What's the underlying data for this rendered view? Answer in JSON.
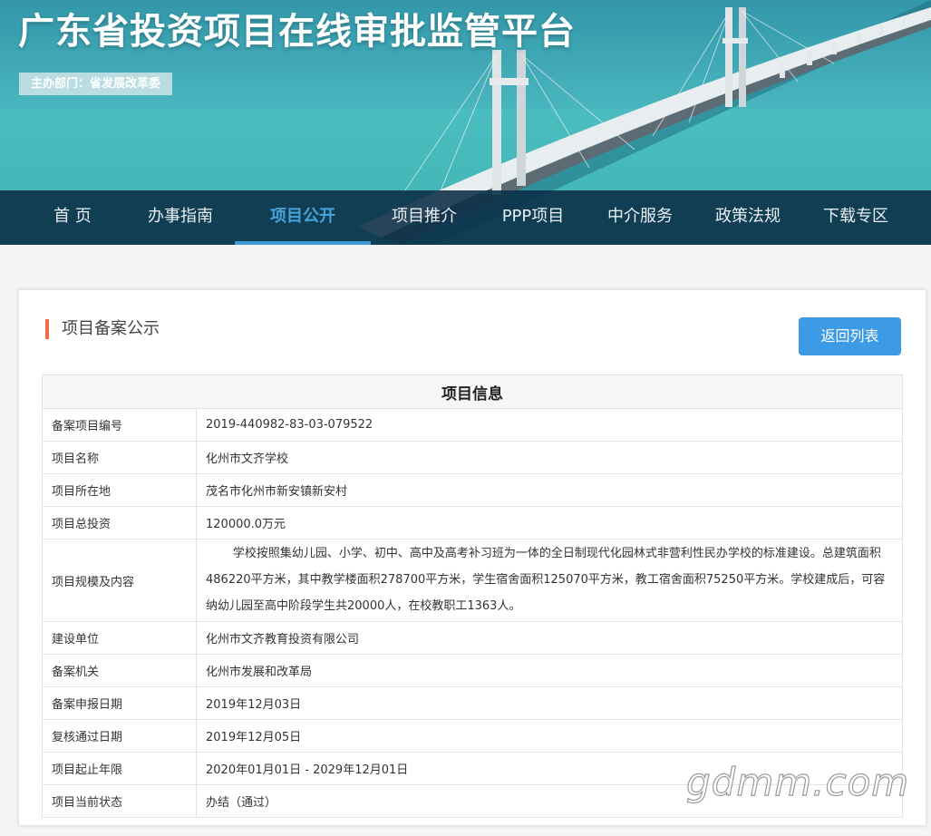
{
  "header": {
    "site_title": "广东省投资项目在线审批监管平台",
    "host_badge": "主办部门：省发展改革委"
  },
  "nav": {
    "items": [
      {
        "label": "首 页",
        "active": false
      },
      {
        "label": "办事指南",
        "active": false
      },
      {
        "label": "项目公开",
        "active": true
      },
      {
        "label": "项目推介",
        "active": false
      },
      {
        "label": "PPP项目",
        "active": false
      },
      {
        "label": "中介服务",
        "active": false
      },
      {
        "label": "政策法规",
        "active": false
      },
      {
        "label": "下载专区",
        "active": false
      }
    ]
  },
  "main": {
    "section_title": "项目备案公示",
    "back_button": "返回列表",
    "table_title": "项目信息",
    "rows": [
      {
        "label": "备案项目编号",
        "value": "2019-440982-83-03-079522"
      },
      {
        "label": "项目名称",
        "value": "化州市文齐学校"
      },
      {
        "label": "项目所在地",
        "value": "茂名市化州市新安镇新安村"
      },
      {
        "label": "项目总投资",
        "value": "120000.0万元"
      },
      {
        "label": "项目规模及内容",
        "value": "学校按照集幼儿园、小学、初中、高中及高考补习班为一体的全日制现代化园林式非营利性民办学校的标准建设。总建筑面积486220平方米，其中教学楼面积278700平方米，学生宿舍面积125070平方米，教工宿舍面积75250平方米。学校建成后，可容纳幼儿园至高中阶段学生共20000人，在校教职工1363人。"
      },
      {
        "label": "建设单位",
        "value": "化州市文齐教育投资有限公司"
      },
      {
        "label": "备案机关",
        "value": "化州市发展和改革局"
      },
      {
        "label": "备案申报日期",
        "value": "2019年12月03日"
      },
      {
        "label": "复核通过日期",
        "value": "2019年12月05日"
      },
      {
        "label": "项目起止年限",
        "value": "2020年01月01日 - 2029年12月01日"
      },
      {
        "label": "项目当前状态",
        "value": "办结（通过）"
      }
    ]
  },
  "watermark": "gdmm.com",
  "colors": {
    "nav_bg": "#0a2d46",
    "nav_active": "#46a3dc",
    "accent_bar": "#f06b4a",
    "button_bg": "#3d9be6"
  }
}
